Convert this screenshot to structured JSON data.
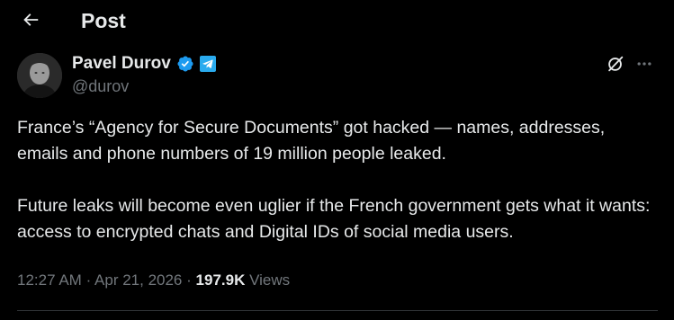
{
  "header": {
    "title": "Post",
    "back_icon": "arrow-left-icon"
  },
  "author": {
    "name": "Pavel Durov",
    "handle": "@durov",
    "avatar": "avatar-image",
    "verified_icon": "verified-badge-icon",
    "affiliation_icon": "telegram-icon"
  },
  "actions": {
    "grok_icon": "grok-icon",
    "more_icon": "more-horizontal-icon"
  },
  "tweet": {
    "paragraphs": [
      "France’s “Agency for Secure Documents” got hacked — names, addresses, emails and phone numbers of 19 million people leaked.",
      "Future leaks will become even uglier if the French government gets what it wants: access to encrypted chats and Digital IDs of social media users."
    ]
  },
  "meta": {
    "time": "12:27 AM",
    "separator": "·",
    "date": "Apr 21, 2026",
    "views_count": "197.9K",
    "views_label": "Views"
  },
  "colors": {
    "background": "#000000",
    "text_primary": "#e7e9ea",
    "text_secondary": "#71767b",
    "verified_blue": "#1d9bf0",
    "telegram_blue": "#2aabee",
    "divider": "#2f3336"
  }
}
